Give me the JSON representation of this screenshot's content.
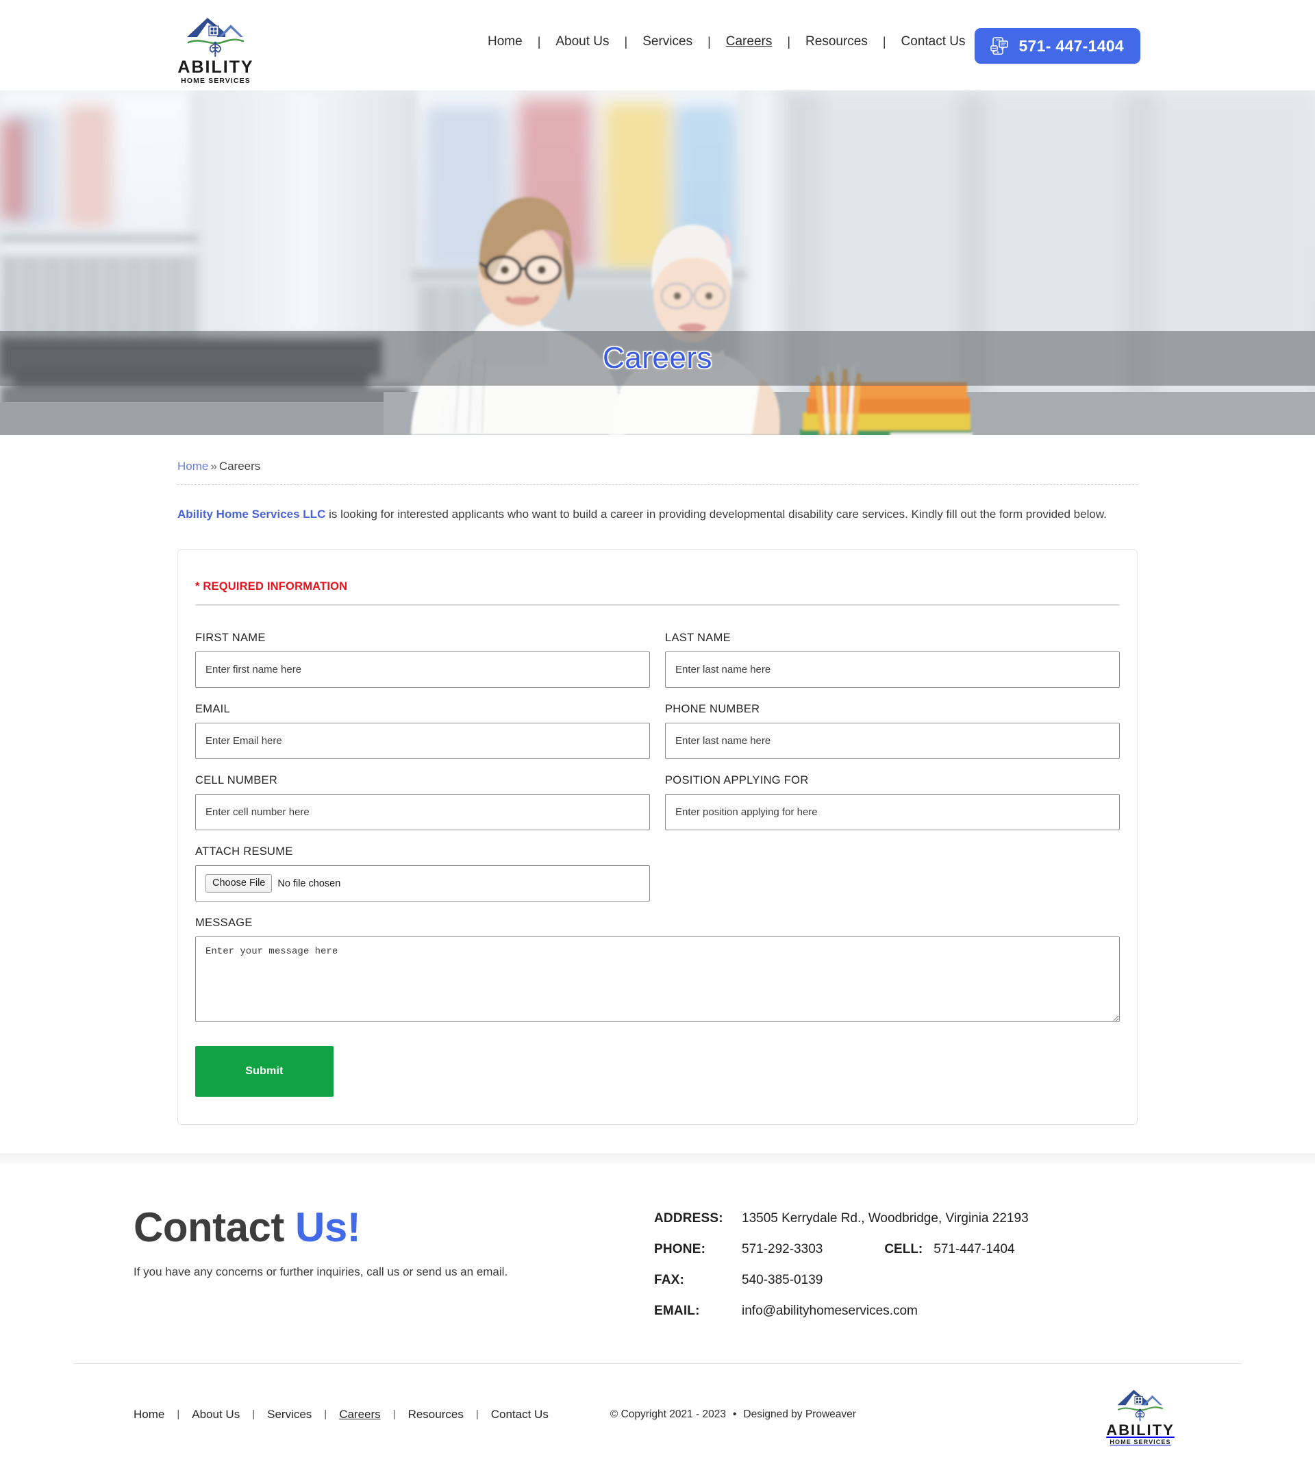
{
  "brand": {
    "name_main": "ABILITY",
    "name_sub": "HOME SERVICES",
    "accent_color": "#4169e8",
    "logo_roof_color": "#2f4c91",
    "logo_swoosh_color": "#4c9a4a"
  },
  "header": {
    "nav": [
      {
        "label": "Home",
        "active": false
      },
      {
        "label": "About Us",
        "active": false
      },
      {
        "label": "Services",
        "active": false
      },
      {
        "label": "Careers",
        "active": true
      },
      {
        "label": "Resources",
        "active": false
      },
      {
        "label": "Contact Us",
        "active": false
      }
    ],
    "separator": "|",
    "phone_button": {
      "number": "571- 447-1404",
      "icon": "mobile-chat-icon",
      "background": "#4169e8"
    }
  },
  "hero": {
    "title": "Careers",
    "title_color": "#3b5ce0",
    "band_color": "rgba(96,100,103,0.55)",
    "image_alt": "Caregiver and young woman with Down syndrome sitting at a desk near a window"
  },
  "breadcrumb": {
    "home": "Home",
    "separator": "»",
    "current": "Careers"
  },
  "intro": {
    "brand_phrase": "Ability Home Services LLC",
    "rest": " is looking for interested applicants who want to build a career in providing developmental disability care services. Kindly fill out the form provided below."
  },
  "form": {
    "required_note": "* REQUIRED INFORMATION",
    "fields": [
      {
        "label": "FIRST NAME",
        "placeholder": "Enter first name here",
        "value": "",
        "type": "text"
      },
      {
        "label": "LAST NAME",
        "placeholder": "Enter last name here",
        "value": "",
        "type": "text"
      },
      {
        "label": "EMAIL",
        "placeholder": "Enter Email here",
        "value": "",
        "type": "text"
      },
      {
        "label": "PHONE NUMBER",
        "placeholder": "Enter last name here",
        "value": "",
        "type": "text"
      },
      {
        "label": "CELL NUMBER",
        "placeholder": "Enter cell number here",
        "value": "",
        "type": "text"
      },
      {
        "label": "POSITION APPLYING FOR",
        "placeholder": "Enter position applying for here",
        "value": "",
        "type": "text"
      }
    ],
    "attach": {
      "label": "ATTACH RESUME",
      "button_label": "Choose File",
      "status": "No file chosen"
    },
    "message": {
      "label": "MESSAGE",
      "placeholder": "Enter your message here",
      "value": ""
    },
    "submit_label": "Submit",
    "submit_color": "#11a243"
  },
  "footer": {
    "heading_part1": "Contact ",
    "heading_part2": "Us!",
    "subtext": "If you have any concerns or further inquiries, call us or send us an email.",
    "contact": {
      "address_label": "ADDRESS:",
      "address_value": "13505 Kerrydale Rd., Woodbridge, Virginia 22193",
      "phone_label": "PHONE:",
      "phone_value": "571-292-3303",
      "cell_label": "CELL:",
      "cell_value": "571-447-1404",
      "fax_label": "FAX:",
      "fax_value": "540-385-0139",
      "email_label": "EMAIL:",
      "email_value": "info@abilityhomeservices.com"
    },
    "nav": [
      {
        "label": "Home",
        "active": false
      },
      {
        "label": "About Us",
        "active": false
      },
      {
        "label": "Services",
        "active": false
      },
      {
        "label": "Careers",
        "active": true
      },
      {
        "label": "Resources",
        "active": false
      },
      {
        "label": "Contact Us",
        "active": false
      }
    ],
    "separator": "|",
    "copyright": "© Copyright 2021 - 2023",
    "copyright_dot": "•",
    "designer": "Designed by Proweaver"
  }
}
